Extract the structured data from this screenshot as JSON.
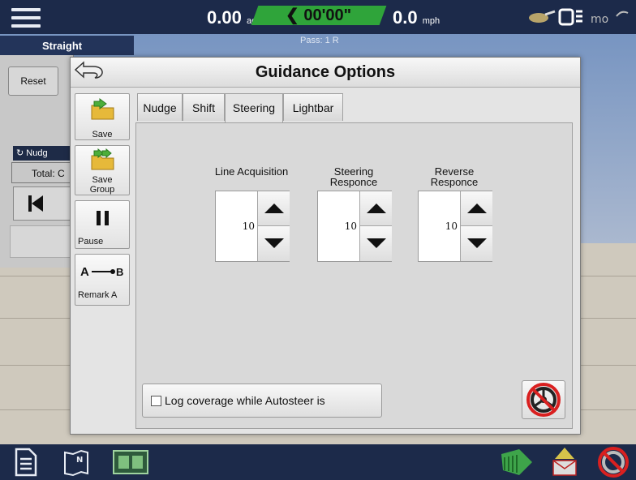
{
  "status_bar": {
    "area_value": "0.00",
    "area_unit": "ac",
    "timer": "00'00\"",
    "speed_value": "0.0",
    "speed_unit": "mph",
    "pass_label": "Pass: 1 R"
  },
  "left_panel": {
    "guidance_tab": "Straight",
    "reset_label": "Reset",
    "nudge_label": "Nudg",
    "total_label": "Total: C"
  },
  "modal": {
    "title": "Guidance Options",
    "side_buttons": {
      "save": "Save",
      "save_group": "Save Group",
      "pause": "Pause",
      "remark": "Remark A"
    },
    "tabs": [
      {
        "label": "Nudge"
      },
      {
        "label": "Shift"
      },
      {
        "label": "Steering"
      },
      {
        "label": "Lightbar"
      }
    ],
    "active_tab": "Steering",
    "fields": [
      {
        "label": "Line Acquisition",
        "value": "10"
      },
      {
        "label": "Steering Responce",
        "value": "10"
      },
      {
        "label": "Reverse Responce",
        "value": "10"
      }
    ],
    "log_coverage_label": "Log coverage while Autosteer is",
    "log_coverage_checked": false
  },
  "colors": {
    "bar_bg": "#1c2a4a",
    "timer_green": "#2fa43a",
    "dialog_bg": "#e4e4e4"
  }
}
